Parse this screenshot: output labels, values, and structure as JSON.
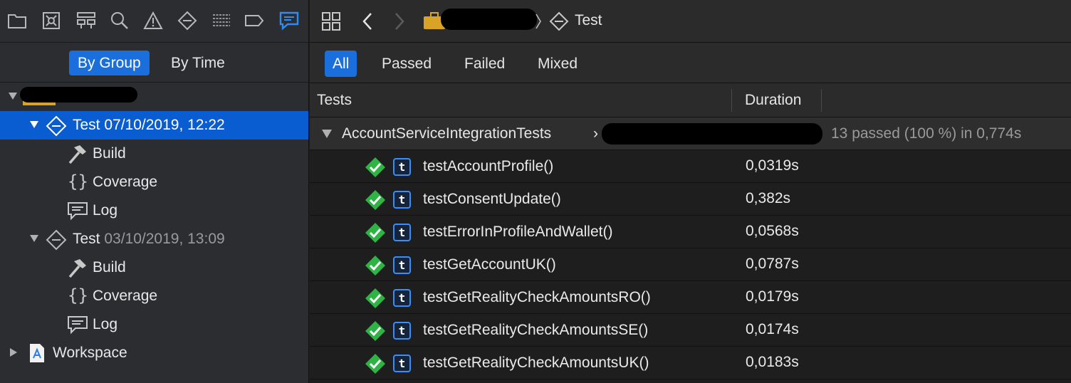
{
  "navigator": {
    "toolbar_icons": [
      "folder-icon",
      "source-control-icon",
      "symbol-hierarchy-icon",
      "search-icon",
      "issue-warning-icon",
      "test-diamond-icon",
      "debug-list-icon",
      "breakpoint-icon",
      "report-chat-icon"
    ],
    "segments": {
      "by_group": "By Group",
      "by_time": "By Time"
    },
    "tree": {
      "root_label": "",
      "runs": [
        {
          "title": "Test",
          "date": "07/10/2019, 12:22",
          "selected": true,
          "children": [
            {
              "label": "Build",
              "icon": "hammer-icon"
            },
            {
              "label": "Coverage",
              "icon": "braces-icon"
            },
            {
              "label": "Log",
              "icon": "log-icon"
            }
          ]
        },
        {
          "title": "Test",
          "date": "03/10/2019, 13:09",
          "selected": false,
          "children": [
            {
              "label": "Build",
              "icon": "hammer-icon"
            },
            {
              "label": "Coverage",
              "icon": "braces-icon"
            },
            {
              "label": "Log",
              "icon": "log-icon"
            }
          ]
        }
      ],
      "workspace": "Workspace"
    }
  },
  "jumpbar": {
    "current": "Test"
  },
  "filters": {
    "all": "All",
    "passed": "Passed",
    "failed": "Failed",
    "mixed": "Mixed",
    "active": "All"
  },
  "table": {
    "headers": {
      "tests": "Tests",
      "duration": "Duration"
    },
    "group": {
      "name": "AccountServiceIntegrationTests",
      "chevron": "›",
      "summary": "13 passed (100 %) in 0,774s"
    },
    "rows": [
      {
        "name": "testAccountProfile()",
        "duration": "0,0319s",
        "status": "passed"
      },
      {
        "name": "testConsentUpdate()",
        "duration": "0,382s",
        "status": "passed"
      },
      {
        "name": "testErrorInProfileAndWallet()",
        "duration": "0,0568s",
        "status": "passed"
      },
      {
        "name": "testGetAccountUK()",
        "duration": "0,0787s",
        "status": "passed"
      },
      {
        "name": "testGetRealityCheckAmountsRO()",
        "duration": "0,0179s",
        "status": "passed"
      },
      {
        "name": "testGetRealityCheckAmountsSE()",
        "duration": "0,0174s",
        "status": "passed"
      },
      {
        "name": "testGetRealityCheckAmountsUK()",
        "duration": "0,0183s",
        "status": "passed"
      }
    ]
  },
  "colors": {
    "accent": "#1a6fdc",
    "selection": "#0a5cd1",
    "pass": "#2fb344",
    "badge": "#3a8ef6"
  }
}
